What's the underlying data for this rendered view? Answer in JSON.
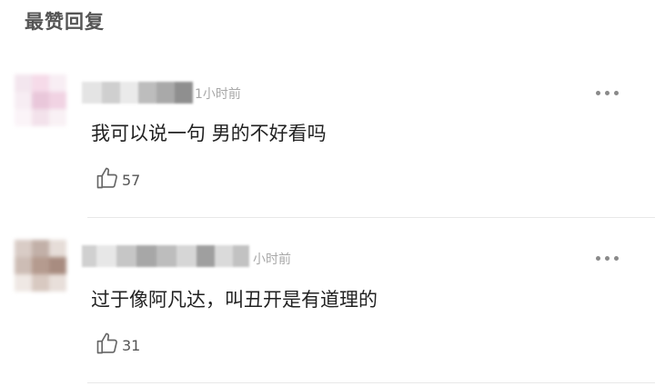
{
  "section": {
    "title": "最赞回复"
  },
  "comments": [
    {
      "time": "1小时前",
      "text": "我可以说一句 男的不好看吗",
      "likes": "57",
      "like_icon": "thumbs-up-icon",
      "more_icon": "more-dots-icon"
    },
    {
      "time": "小时前",
      "text": "过于像阿凡达，叫丑开是有道理的",
      "likes": "31",
      "like_icon": "thumbs-up-icon",
      "more_icon": "more-dots-icon"
    }
  ],
  "colors": {
    "text_primary": "#222222",
    "text_secondary": "#a8a8a8",
    "icon": "#8a8a8a",
    "divider": "#e8e8e8"
  }
}
